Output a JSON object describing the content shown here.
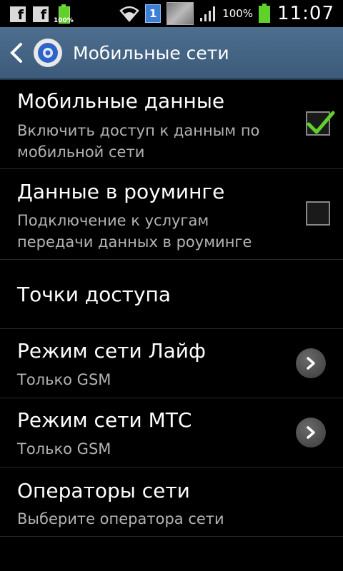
{
  "status_bar": {
    "icons_left": [
      "facebook-icon",
      "facebook-icon",
      "battery-icon"
    ],
    "battery_small_pct": "100%",
    "notification_count": "1",
    "battery_pct": "100%",
    "time": "11:07"
  },
  "action_bar": {
    "title": "Мобильные сети",
    "icon": "gear-icon",
    "accent": "#4e6e8f"
  },
  "settings": [
    {
      "title": "Мобильные данные",
      "summary": "Включить доступ к данным по мобильной сети",
      "control": "checkbox",
      "checked": true
    },
    {
      "title": "Данные в роуминге",
      "summary": "Подключение к услугам передачи данных в роуминге",
      "control": "checkbox",
      "checked": false
    },
    {
      "title": "Точки доступа",
      "summary": ""
    },
    {
      "title": "Режим сети Лайф",
      "summary": "Только GSM",
      "control": "chevron"
    },
    {
      "title": "Режим сети МТС",
      "summary": "Только GSM",
      "control": "chevron"
    },
    {
      "title": "Операторы сети",
      "summary": "Выберите оператора сети"
    }
  ],
  "colors": {
    "check": "#5fd12a",
    "background": "#000000"
  }
}
